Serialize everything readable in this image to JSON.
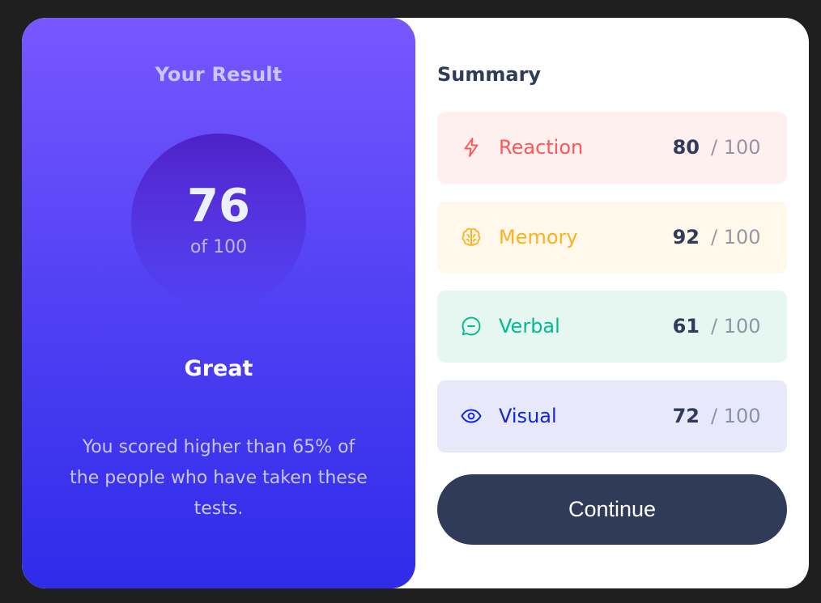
{
  "result": {
    "title": "Your Result",
    "score": "76",
    "of_label": "of 100",
    "grade": "Great",
    "description": "You scored higher than 65% of the people who have taken these tests."
  },
  "summary": {
    "title": "Summary",
    "items": [
      {
        "icon": "lightning-icon",
        "label": "Reaction",
        "score": "80",
        "max": "/ 100",
        "color": "#ff5757",
        "bg": "#fff0f0"
      },
      {
        "icon": "brain-icon",
        "label": "Memory",
        "score": "92",
        "max": "/ 100",
        "color": "#ffb01f",
        "bg": "#fff8eb"
      },
      {
        "icon": "chat-bubble-icon",
        "label": "Verbal",
        "score": "61",
        "max": "/ 100",
        "color": "#00bb8f",
        "bg": "#e6f7f2"
      },
      {
        "icon": "eye-icon",
        "label": "Visual",
        "score": "72",
        "max": "/ 100",
        "color": "#1125d6",
        "bg": "#e7e8fa"
      }
    ]
  },
  "continue_button": {
    "label": "Continue"
  },
  "colors": {
    "gradient_top": "#7857ff",
    "gradient_bottom": "#2e2be9",
    "dark_navy": "#303b5a",
    "page_background": "#1f1f1f"
  }
}
